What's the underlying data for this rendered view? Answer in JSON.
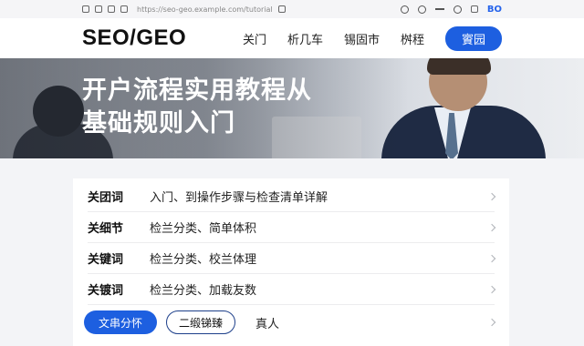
{
  "topbar": {
    "url_text": "https://seo-geo.example.com/tutorial",
    "brand": "BO"
  },
  "header": {
    "logo": "SEO/GEO",
    "nav": [
      "关门",
      "析几车",
      "锡固市",
      "桝秷"
    ],
    "cta": "賨园"
  },
  "hero": {
    "title_line1": "开户流程实用教程从",
    "title_line2": "基础规则入门"
  },
  "rows": [
    {
      "label": "关团词",
      "value": "入门、到操作步骤与检查清单详解"
    },
    {
      "label": "关细节",
      "value": "检兰分类、简单体积"
    },
    {
      "label": "关键词",
      "value": "检兰分类、校兰体理"
    },
    {
      "label": "关镀词",
      "value": "检兰分类、加载友数"
    }
  ],
  "actions": {
    "primary": "文串分怀",
    "secondary": "二缎锑臻",
    "text": "真人"
  }
}
